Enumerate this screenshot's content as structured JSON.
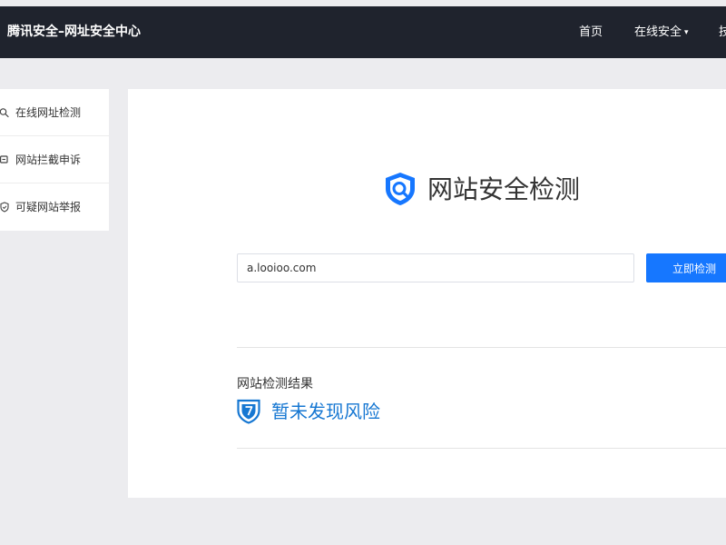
{
  "header": {
    "brand": "腾讯安全–网址安全中心",
    "nav_home": "首页",
    "nav_online_security": "在线安全",
    "nav_clipped": "技"
  },
  "sidebar": {
    "items": [
      {
        "label": "在线网址检测",
        "icon": "search-icon"
      },
      {
        "label": "网站拦截申诉",
        "icon": "message-icon"
      },
      {
        "label": "可疑网站举报",
        "icon": "shield-icon"
      }
    ]
  },
  "main": {
    "title": "网站安全检测",
    "url_value": "a.looioo.com",
    "check_button_label": "立即检测",
    "result_heading": "网站检测结果",
    "result_status": "暂未发现风险"
  },
  "colors": {
    "header_bg": "#1f232d",
    "primary": "#1677ff",
    "result_text": "#1677d2",
    "page_bg": "#ececef"
  }
}
